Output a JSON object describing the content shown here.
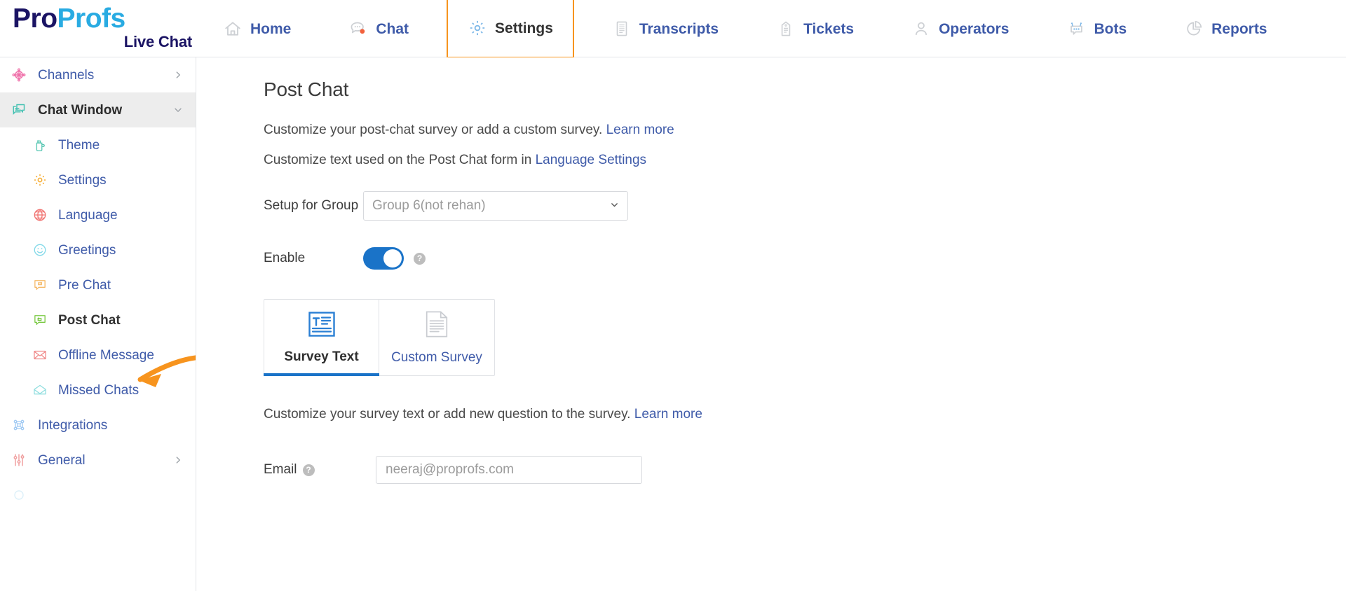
{
  "brand": {
    "logo_pro": "Pro",
    "logo_profs": "Profs",
    "logo_sub": "Live Chat",
    "colors": {
      "navy": "#1b1464",
      "sky": "#29abe2",
      "link_blue": "#3f5ba9",
      "accent_orange": "#f7941e",
      "toggle_blue": "#1a73c8"
    }
  },
  "topnav": {
    "items": [
      {
        "label": "Home",
        "icon": "home-icon",
        "active": false
      },
      {
        "label": "Chat",
        "icon": "chat-bubble-icon",
        "active": false
      },
      {
        "label": "Settings",
        "icon": "gear-icon",
        "active": true
      },
      {
        "label": "Transcripts",
        "icon": "document-icon",
        "active": false
      },
      {
        "label": "Tickets",
        "icon": "ticket-tag-icon",
        "active": false
      },
      {
        "label": "Operators",
        "icon": "user-icon",
        "active": false
      },
      {
        "label": "Bots",
        "icon": "robot-icon",
        "active": false
      },
      {
        "label": "Reports",
        "icon": "pie-chart-icon",
        "active": false
      }
    ]
  },
  "sidebar": {
    "items": [
      {
        "label": "Channels",
        "icon": "channels-network-icon",
        "level": "top",
        "state": "normal",
        "chevron": "right",
        "icon_color": "#ef6ea8"
      },
      {
        "label": "Chat Window",
        "icon": "chat-window-icon",
        "level": "top",
        "state": "highlight",
        "chevron": "down",
        "icon_color": "#3fc0b0"
      },
      {
        "label": "Theme",
        "icon": "paint-cup-icon",
        "level": "sub",
        "state": "normal",
        "chevron": "",
        "icon_color": "#56c6b2"
      },
      {
        "label": "Settings",
        "icon": "gear-icon",
        "level": "sub",
        "state": "normal",
        "chevron": "",
        "icon_color": "#f5a623"
      },
      {
        "label": "Language",
        "icon": "globe-icon",
        "level": "sub",
        "state": "normal",
        "chevron": "",
        "icon_color": "#f0706e"
      },
      {
        "label": "Greetings",
        "icon": "smiley-icon",
        "level": "sub",
        "state": "normal",
        "chevron": "",
        "icon_color": "#7fd8e8"
      },
      {
        "label": "Pre Chat",
        "icon": "pre-chat-icon",
        "level": "sub",
        "state": "normal",
        "chevron": "",
        "icon_color": "#f5b968"
      },
      {
        "label": "Post Chat",
        "icon": "post-chat-icon",
        "level": "sub",
        "state": "current",
        "chevron": "",
        "icon_color": "#7ac943"
      },
      {
        "label": "Offline Message",
        "icon": "envelope-icon",
        "level": "sub",
        "state": "normal",
        "chevron": "",
        "icon_color": "#f08a8a"
      },
      {
        "label": "Missed Chats",
        "icon": "open-envelope-icon",
        "level": "sub",
        "state": "normal",
        "chevron": "",
        "icon_color": "#93dfe0"
      },
      {
        "label": "Integrations",
        "icon": "integrations-icon",
        "level": "top",
        "state": "normal",
        "chevron": "",
        "icon_color": "#9fc9f3"
      },
      {
        "label": "General",
        "icon": "sliders-icon",
        "level": "top",
        "state": "normal",
        "chevron": "right",
        "icon_color": "#f0a0a0"
      }
    ]
  },
  "main": {
    "title": "Post Chat",
    "desc1_text": "Customize your post-chat survey or add a custom survey.",
    "desc1_link": "Learn more",
    "desc2_text": "Customize text used on the Post Chat form in",
    "desc2_link": "Language Settings",
    "setup_group": {
      "label": "Setup for Group",
      "value": "Group 6(not rehan)",
      "caret": "chevron-down-icon"
    },
    "enable": {
      "label": "Enable",
      "state": "on",
      "help": "?"
    },
    "tabs": [
      {
        "label": "Survey Text",
        "icon": "survey-text-icon",
        "active": true
      },
      {
        "label": "Custom Survey",
        "icon": "custom-survey-icon",
        "active": false
      }
    ],
    "survey_desc_text": "Customize your survey text or add new question to the survey.",
    "survey_desc_link": "Learn more",
    "email": {
      "label": "Email",
      "help": "?",
      "placeholder": "neeraj@proprofs.com",
      "value": ""
    }
  },
  "annotation": {
    "type": "arrow",
    "color": "#f7941e",
    "points_to": "Post Chat"
  }
}
